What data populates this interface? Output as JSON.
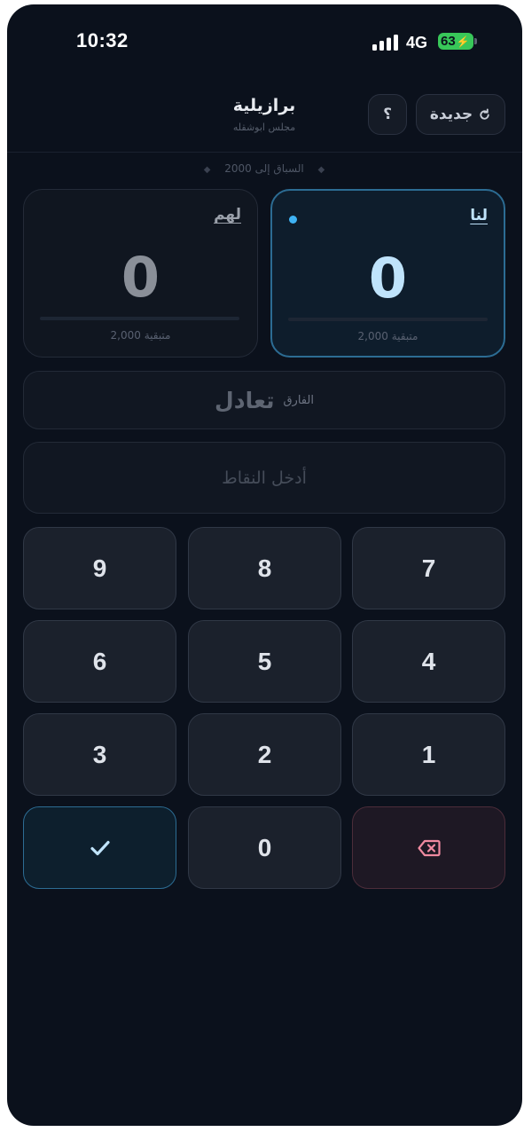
{
  "status_bar": {
    "time": "10:32",
    "network": "4G",
    "battery": "63"
  },
  "header": {
    "title": "برازيلية",
    "subtitle": "مجلس ابوشقله",
    "new_game_label": "جديدة",
    "help_label": "؟"
  },
  "race_target": "السباق إلى 2000",
  "teams": {
    "us": {
      "label": "لنا",
      "score": "0",
      "remaining": "2,000 متبقية",
      "active": true
    },
    "them": {
      "label": "لهم",
      "score": "0",
      "remaining": "2,000 متبقية"
    }
  },
  "difference": {
    "label": "الفارق",
    "value": "تعادل"
  },
  "points_input": {
    "placeholder": "أدخل النقاط"
  },
  "keypad": {
    "row1": [
      "7",
      "8",
      "9"
    ],
    "row2": [
      "4",
      "5",
      "6"
    ],
    "row3": [
      "1",
      "2",
      "3"
    ],
    "zero": "0",
    "confirm_icon": "check-icon",
    "delete_icon": "backspace-icon"
  },
  "colors": {
    "background": "#0b111c",
    "accent": "#3fb3f4",
    "us_score": "#bfe3fb",
    "them_score": "#8a8f98",
    "delete_accent": "#f08aa0",
    "battery": "#38c759"
  }
}
